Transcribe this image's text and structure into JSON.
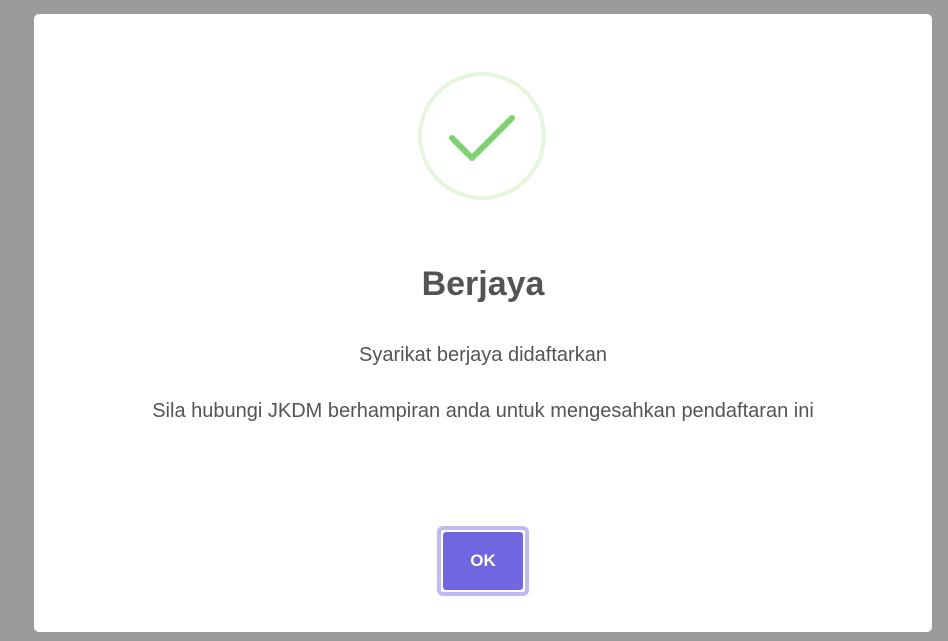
{
  "dialog": {
    "icon": "success-check-icon",
    "title": "Berjaya",
    "message": "Syarikat berjaya didaftarkan",
    "note": "Sila hubungi JKDM berhampiran anda untuk mengesahkan pendaftaran ini",
    "confirm_label": "OK"
  },
  "colors": {
    "overlay": "#9b9b9b",
    "dialog_bg": "#ffffff",
    "success": "#a5dc86",
    "text": "#545454",
    "confirm_button": "#7066e0"
  }
}
